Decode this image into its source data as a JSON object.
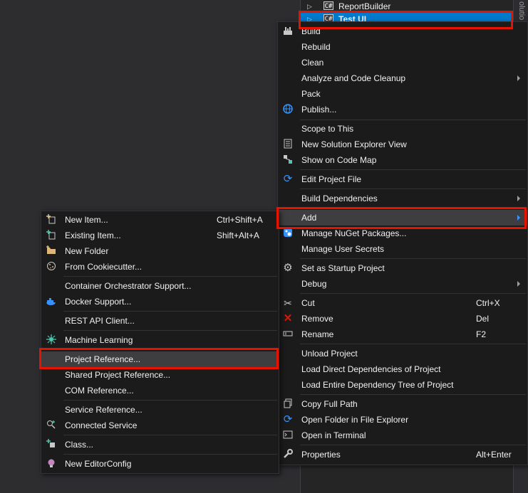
{
  "solution_explorer": {
    "title_fragment": "olutio",
    "items": [
      {
        "label": "ReportBuilder",
        "icon": "C#"
      },
      {
        "label": "Test UI",
        "icon": "C#"
      }
    ]
  },
  "context_menu": {
    "build": "Build",
    "rebuild": "Rebuild",
    "clean": "Clean",
    "analyze": "Analyze and Code Cleanup",
    "pack": "Pack",
    "publish": "Publish...",
    "scope_to_this": "Scope to This",
    "new_solution_view": "New Solution Explorer View",
    "show_code_map": "Show on Code Map",
    "edit_project_file": "Edit Project File",
    "build_dependencies": "Build Dependencies",
    "add": "Add",
    "manage_nuget": "Manage NuGet Packages...",
    "manage_secrets": "Manage User Secrets",
    "set_startup": "Set as Startup Project",
    "debug": "Debug",
    "cut": "Cut",
    "cut_shortcut": "Ctrl+X",
    "remove": "Remove",
    "remove_shortcut": "Del",
    "rename": "Rename",
    "rename_shortcut": "F2",
    "unload_project": "Unload Project",
    "load_direct": "Load Direct Dependencies of Project",
    "load_entire": "Load Entire Dependency Tree of Project",
    "copy_full_path": "Copy Full Path",
    "open_folder": "Open Folder in File Explorer",
    "open_terminal": "Open in Terminal",
    "properties": "Properties",
    "properties_shortcut": "Alt+Enter"
  },
  "add_submenu": {
    "new_item": "New Item...",
    "new_item_shortcut": "Ctrl+Shift+A",
    "existing_item": "Existing Item...",
    "existing_item_shortcut": "Shift+Alt+A",
    "new_folder": "New Folder",
    "from_cookiecutter": "From Cookiecutter...",
    "container_orchestrator": "Container Orchestrator Support...",
    "docker_support": "Docker Support...",
    "rest_api_client": "REST API Client...",
    "machine_learning": "Machine Learning",
    "project_reference": "Project Reference...",
    "shared_project_reference": "Shared Project Reference...",
    "com_reference": "COM Reference...",
    "service_reference": "Service Reference...",
    "connected_service": "Connected Service",
    "class": "Class...",
    "new_editorconfig": "New EditorConfig"
  },
  "colors": {
    "highlight_box": "#e51400",
    "selection": "#007acc",
    "menu_bg": "#1b1b1c"
  }
}
